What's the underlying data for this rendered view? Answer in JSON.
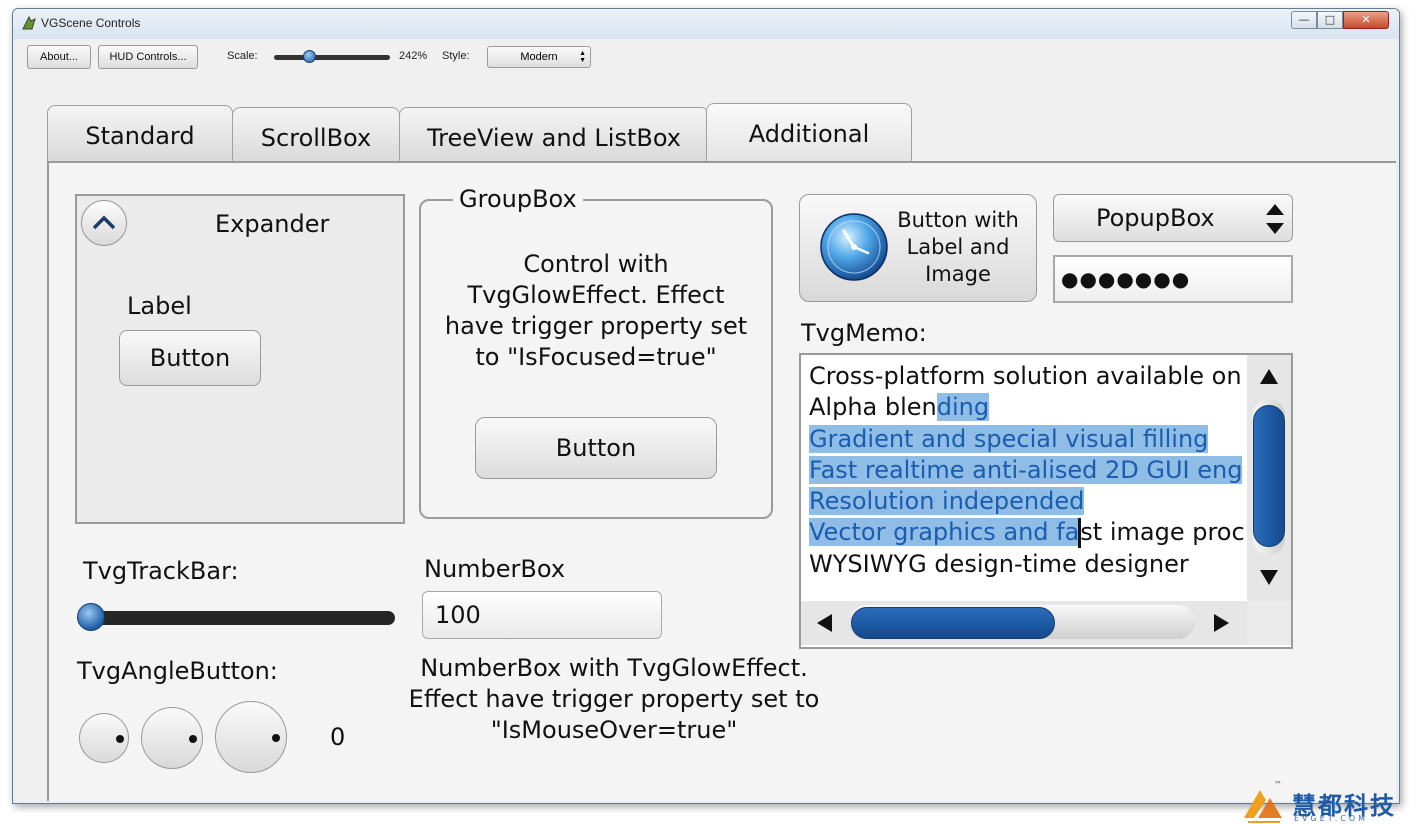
{
  "window": {
    "title": "VGScene Controls",
    "minimize_glyph": "—",
    "maximize_glyph": "□",
    "close_glyph": "✕"
  },
  "toolbar": {
    "about_label": "About...",
    "hud_label": "HUD Controls...",
    "scale_label": "Scale:",
    "scale_value": "242%",
    "scale_fraction": 0.27,
    "style_label": "Style:",
    "style_value": "Modern"
  },
  "tabs": [
    {
      "label": "Standard"
    },
    {
      "label": "ScrollBox"
    },
    {
      "label": "TreeView and ListBox"
    },
    {
      "label": "Additional"
    }
  ],
  "expander": {
    "header": "Expander",
    "label": "Label",
    "button_label": "Button"
  },
  "groupbox": {
    "title": "GroupBox",
    "text_lines": [
      "Control with",
      "TvgGlowEffect. Effect",
      "have trigger property set",
      "to \"IsFocused=true\""
    ],
    "button_label": "Button"
  },
  "image_button": {
    "lines": [
      "Button with",
      "Label and",
      "Image"
    ]
  },
  "popupbox": {
    "value": "PopupBox"
  },
  "password": {
    "value": "●●●●●●●"
  },
  "memo": {
    "label": "TvgMemo:",
    "lines": [
      {
        "plain": "Cross-platform solution available on",
        "selected": ""
      },
      {
        "plain": "Alpha blen",
        "selected": "ding"
      },
      {
        "plain": "",
        "selected": "Gradient and special visual filling"
      },
      {
        "plain": "",
        "selected": "Fast realtime anti-alised 2D GUI eng"
      },
      {
        "plain": "",
        "selected": "Resolution independed"
      },
      {
        "plain": "",
        "selected": "Vector graphics and fa",
        "after": "st image proc"
      },
      {
        "plain": "WYSIWYG design-time designer",
        "selected": ""
      }
    ]
  },
  "trackbar": {
    "label": "TvgTrackBar:",
    "value_fraction": 0.0
  },
  "numberbox": {
    "label": "NumberBox",
    "value": "100",
    "caption_lines": [
      "NumberBox with TvgGlowEffect.",
      "Effect have trigger property set to",
      "\"IsMouseOver=true\""
    ]
  },
  "angle_button": {
    "label": "TvgAngleButton:",
    "value": "0"
  },
  "watermark": {
    "text": "慧都科技",
    "sub": "EVGET.COM",
    "tm": "™"
  },
  "colors": {
    "accent": "#1e5aa5",
    "selection": "#8fbde6"
  }
}
